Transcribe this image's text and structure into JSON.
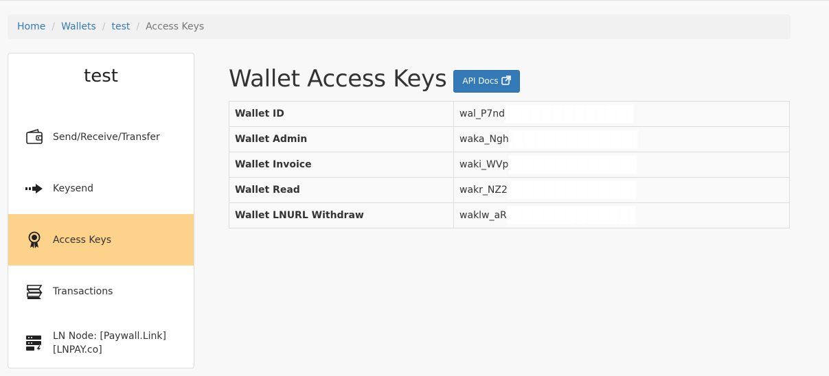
{
  "breadcrumb": {
    "home": "Home",
    "wallets": "Wallets",
    "test": "test",
    "current": "Access Keys",
    "separator": "/"
  },
  "sidebar": {
    "wallet_name": "test",
    "items": [
      {
        "label": "Send/Receive/Transfer",
        "icon": "wallet-icon"
      },
      {
        "label": "Keysend",
        "icon": "arrow-right-icon"
      },
      {
        "label": "Access Keys",
        "icon": "key-badge-icon",
        "active": true
      },
      {
        "label": "Transactions",
        "icon": "stacked-bills-icon"
      },
      {
        "label": "LN Node: [Paywall.Link] [LNPAY.co]",
        "icon": "server-lightning-icon"
      }
    ]
  },
  "main": {
    "title": "Wallet Access Keys",
    "api_docs_label": "API Docs",
    "keys": [
      {
        "name": "Wallet ID",
        "value": "wal_P7nd"
      },
      {
        "name": "Wallet Admin",
        "value": "waka_Ngh"
      },
      {
        "name": "Wallet Invoice",
        "value": "waki_WVp"
      },
      {
        "name": "Wallet Read",
        "value": "wakr_NZ2"
      },
      {
        "name": "Wallet LNURL Withdraw",
        "value": "waklw_aR"
      }
    ]
  },
  "colors": {
    "link": "#337ab7",
    "active_nav": "#fdd28a",
    "button": "#337ab7"
  }
}
